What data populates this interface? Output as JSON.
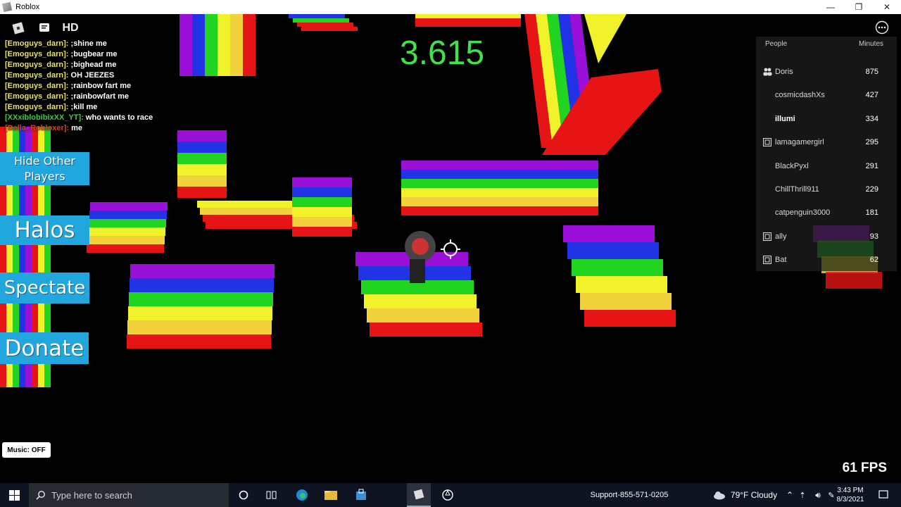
{
  "window": {
    "title": "Roblox",
    "controls": [
      "—",
      "❐",
      "✕"
    ]
  },
  "top_icons": {
    "hd_label": "HD"
  },
  "chat": [
    {
      "name": "[Emoguys_darn]:",
      "msg": ";shine me",
      "color": "y"
    },
    {
      "name": "[Emoguys_darn]:",
      "msg": ";bugbear me",
      "color": "y"
    },
    {
      "name": "[Emoguys_darn]:",
      "msg": ";bighead me",
      "color": "y"
    },
    {
      "name": "[Emoguys_darn]:",
      "msg": "OH JEEZES",
      "color": "y"
    },
    {
      "name": "[Emoguys_darn]:",
      "msg": ";rainbow fart me",
      "color": "y"
    },
    {
      "name": "[Emoguys_darn]:",
      "msg": ";rainbowfart me",
      "color": "y"
    },
    {
      "name": "[Emoguys_darn]:",
      "msg": ";kill me",
      "color": "y"
    },
    {
      "name": "[XXxiblobibixXX_YT]:",
      "msg": "who wants to race",
      "color": "g"
    },
    {
      "name": "[Bella_Robloxer]:",
      "msg": "me",
      "color": "r"
    }
  ],
  "timer": "3.615",
  "buttons": {
    "hide_players": "Hide Other Players",
    "halos": "Halos",
    "spectate": "Spectate",
    "donate": "Donate",
    "music": "Music: OFF"
  },
  "players": {
    "header_left": "People",
    "header_right": "Minutes",
    "list": [
      {
        "name": "Doris",
        "minutes": "875",
        "icon": "friends-icon",
        "strong": false
      },
      {
        "name": "cosmicdashXs",
        "minutes": "427",
        "icon": "",
        "strong": false
      },
      {
        "name": "illumi",
        "minutes": "334",
        "icon": "",
        "strong": true
      },
      {
        "name": "lamagamergirl",
        "minutes": "295",
        "icon": "premium-icon",
        "strong": false
      },
      {
        "name": "BlackPyxl",
        "minutes": "291",
        "icon": "",
        "strong": false
      },
      {
        "name": "ChillThrill911",
        "minutes": "229",
        "icon": "",
        "strong": false
      },
      {
        "name": "catpenguin3000",
        "minutes": "181",
        "icon": "",
        "strong": false
      },
      {
        "name": "ally",
        "minutes": "93",
        "icon": "premium-icon",
        "strong": false
      },
      {
        "name": "Bat",
        "minutes": "62",
        "icon": "premium-icon",
        "strong": false
      }
    ]
  },
  "fps": "61 FPS",
  "taskbar": {
    "search_placeholder": "Type here to search",
    "support": "Support-855-571-0205",
    "weather": "79°F  Cloudy",
    "time": "3:43 PM",
    "date": "8/3/2021"
  },
  "colors": {
    "rainbow": [
      "#9b10d8",
      "#2233e6",
      "#22d422",
      "#f2f22a",
      "#f2d23a",
      "#e61414"
    ],
    "timer": "#3fe14d",
    "button": "#22a6de"
  }
}
